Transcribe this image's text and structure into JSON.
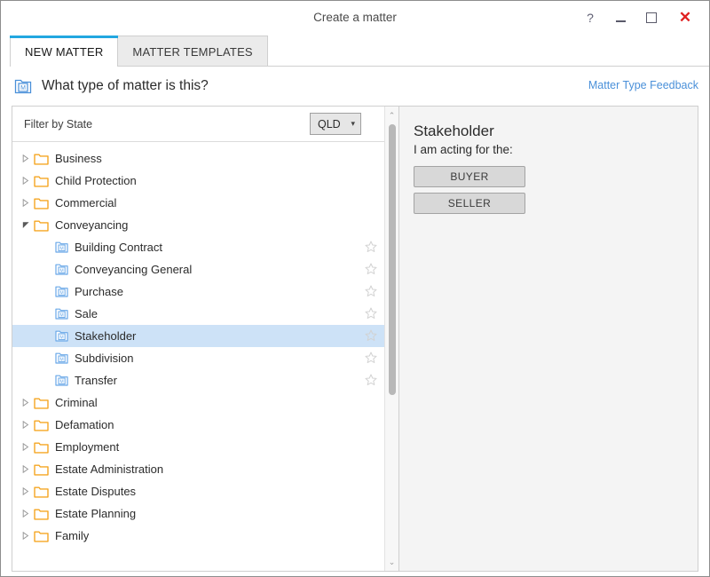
{
  "window": {
    "title": "Create a matter",
    "controls": {
      "help": "?",
      "minimize": "",
      "maximize": "",
      "close": "✕"
    }
  },
  "tabs": [
    {
      "label": "NEW MATTER",
      "active": true
    },
    {
      "label": "MATTER TEMPLATES",
      "active": false
    }
  ],
  "header": {
    "question": "What type of matter is this?",
    "feedback_link": "Matter Type Feedback",
    "icon": "matter-type-icon"
  },
  "filter": {
    "label": "Filter by State",
    "state_value": "QLD",
    "chevron": "⌄"
  },
  "tree": [
    {
      "label": "Business",
      "type": "folder",
      "level": 0,
      "expanded": false,
      "selected": false,
      "star": false
    },
    {
      "label": "Child Protection",
      "type": "folder",
      "level": 0,
      "expanded": false,
      "selected": false,
      "star": false
    },
    {
      "label": "Commercial",
      "type": "folder",
      "level": 0,
      "expanded": false,
      "selected": false,
      "star": false
    },
    {
      "label": "Conveyancing",
      "type": "folder",
      "level": 0,
      "expanded": true,
      "selected": false,
      "star": false
    },
    {
      "label": "Building Contract",
      "type": "matter",
      "level": 1,
      "expanded": null,
      "selected": false,
      "star": true
    },
    {
      "label": "Conveyancing General",
      "type": "matter",
      "level": 1,
      "expanded": null,
      "selected": false,
      "star": true
    },
    {
      "label": "Purchase",
      "type": "matter",
      "level": 1,
      "expanded": null,
      "selected": false,
      "star": true
    },
    {
      "label": "Sale",
      "type": "matter",
      "level": 1,
      "expanded": null,
      "selected": false,
      "star": true
    },
    {
      "label": "Stakeholder",
      "type": "matter",
      "level": 1,
      "expanded": null,
      "selected": true,
      "star": true
    },
    {
      "label": "Subdivision",
      "type": "matter",
      "level": 1,
      "expanded": null,
      "selected": false,
      "star": true
    },
    {
      "label": "Transfer",
      "type": "matter",
      "level": 1,
      "expanded": null,
      "selected": false,
      "star": true
    },
    {
      "label": "Criminal",
      "type": "folder",
      "level": 0,
      "expanded": false,
      "selected": false,
      "star": false
    },
    {
      "label": "Defamation",
      "type": "folder",
      "level": 0,
      "expanded": false,
      "selected": false,
      "star": false
    },
    {
      "label": "Employment",
      "type": "folder",
      "level": 0,
      "expanded": false,
      "selected": false,
      "star": false
    },
    {
      "label": "Estate Administration",
      "type": "folder",
      "level": 0,
      "expanded": false,
      "selected": false,
      "star": false
    },
    {
      "label": "Estate Disputes",
      "type": "folder",
      "level": 0,
      "expanded": false,
      "selected": false,
      "star": false
    },
    {
      "label": "Estate Planning",
      "type": "folder",
      "level": 0,
      "expanded": false,
      "selected": false,
      "star": false
    },
    {
      "label": "Family",
      "type": "folder",
      "level": 0,
      "expanded": false,
      "selected": false,
      "star": false
    }
  ],
  "detail": {
    "title": "Stakeholder",
    "subtitle": "I am acting for the:",
    "options": [
      {
        "label": "BUYER"
      },
      {
        "label": "SELLER"
      }
    ]
  },
  "scrollbar": {
    "up_arrow": "⌃",
    "down_arrow": "⌄"
  },
  "colors": {
    "accent_blue": "#23a7e0",
    "link_blue": "#4a90d9",
    "selection_blue": "#cde2f7",
    "folder_orange": "#f5a623",
    "close_red": "#e02020",
    "panel_gray": "#f4f4f4"
  }
}
